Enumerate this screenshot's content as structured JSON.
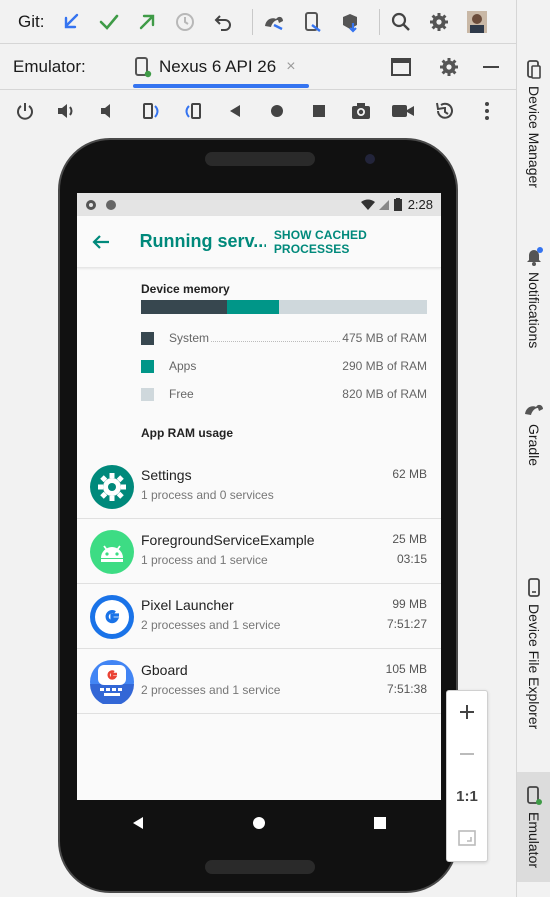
{
  "toolbar": {
    "git_label": "Git:",
    "icons": [
      "update-icon",
      "commit-icon",
      "push-icon",
      "history-icon",
      "rollback-icon",
      "gradle-sync-icon",
      "device-manager-icon",
      "sdk-manager-icon",
      "search-icon",
      "settings-icon",
      "avatar"
    ]
  },
  "emulator": {
    "label": "Emulator:",
    "device_tab": "Nexus 6 API 26",
    "tab_close": "×"
  },
  "sidebar": {
    "items": [
      {
        "label": "Device Manager"
      },
      {
        "label": "Notifications"
      },
      {
        "label": "Gradle"
      },
      {
        "label": "Device File Explorer"
      },
      {
        "label": "Emulator"
      }
    ]
  },
  "phone": {
    "status_time": "2:28",
    "app_title": "Running serv...",
    "cached_button": "SHOW CACHED PROCESSES",
    "device_memory_title": "Device memory",
    "memory": {
      "system_fraction": 0.3,
      "apps_fraction": 0.184,
      "free_fraction": 0.516,
      "legend": [
        {
          "name": "System",
          "value": "475 MB of RAM",
          "color": "#37474f"
        },
        {
          "name": "Apps",
          "value": "290 MB of RAM",
          "color": "#009688"
        },
        {
          "name": "Free",
          "value": "820 MB of RAM",
          "color": "#cfd8dc"
        }
      ]
    },
    "app_ram_title": "App RAM usage",
    "apps": [
      {
        "name": "Settings",
        "sub": "1 process and 0 services",
        "mem": "62 MB",
        "time": ""
      },
      {
        "name": "ForegroundServiceExample",
        "sub": "1 process and 1 service",
        "mem": "25 MB",
        "time": "03:15"
      },
      {
        "name": "Pixel Launcher",
        "sub": "2 processes and 1 service",
        "mem": "99 MB",
        "time": "7:51:27"
      },
      {
        "name": "Gboard",
        "sub": "2 processes and 1 service",
        "mem": "105 MB",
        "time": "7:51:38"
      }
    ]
  },
  "zoom": {
    "one_to_one": "1:1"
  }
}
